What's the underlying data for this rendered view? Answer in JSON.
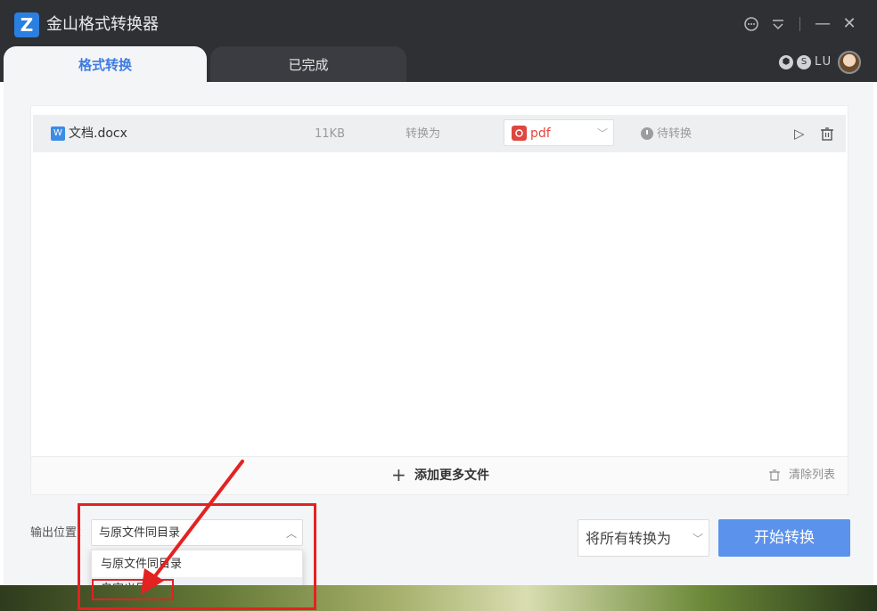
{
  "app": {
    "title": "金山格式转换器",
    "logo_letter": "Z"
  },
  "window_controls": {
    "feedback_icon": "chat-bubble-icon",
    "menu_icon": "menu-icon",
    "minimize": "—",
    "close": "✕"
  },
  "tabs": [
    {
      "label": "格式转换",
      "active": true
    },
    {
      "label": "已完成",
      "active": false
    }
  ],
  "user": {
    "initials": "LU",
    "badges": [
      "⬢",
      "S"
    ]
  },
  "files": [
    {
      "icon_letter": "W",
      "name": "文档.docx",
      "size": "11KB",
      "convert_label": "转换为",
      "target_format": "pdf",
      "status": "待转换"
    }
  ],
  "file_panel": {
    "add_more_label": "添加更多文件",
    "clear_list_label": "清除列表"
  },
  "output": {
    "label": "输出位置：",
    "selected": "与原文件同目录",
    "options": [
      "与原文件同目录",
      "自定义目录"
    ]
  },
  "actions": {
    "convert_all_label": "将所有转换为",
    "start_label": "开始转换"
  },
  "colors": {
    "accent": "#5b92ec",
    "titlebar": "#2f3034",
    "pdf": "#e0463f",
    "annotation": "#e32222"
  }
}
